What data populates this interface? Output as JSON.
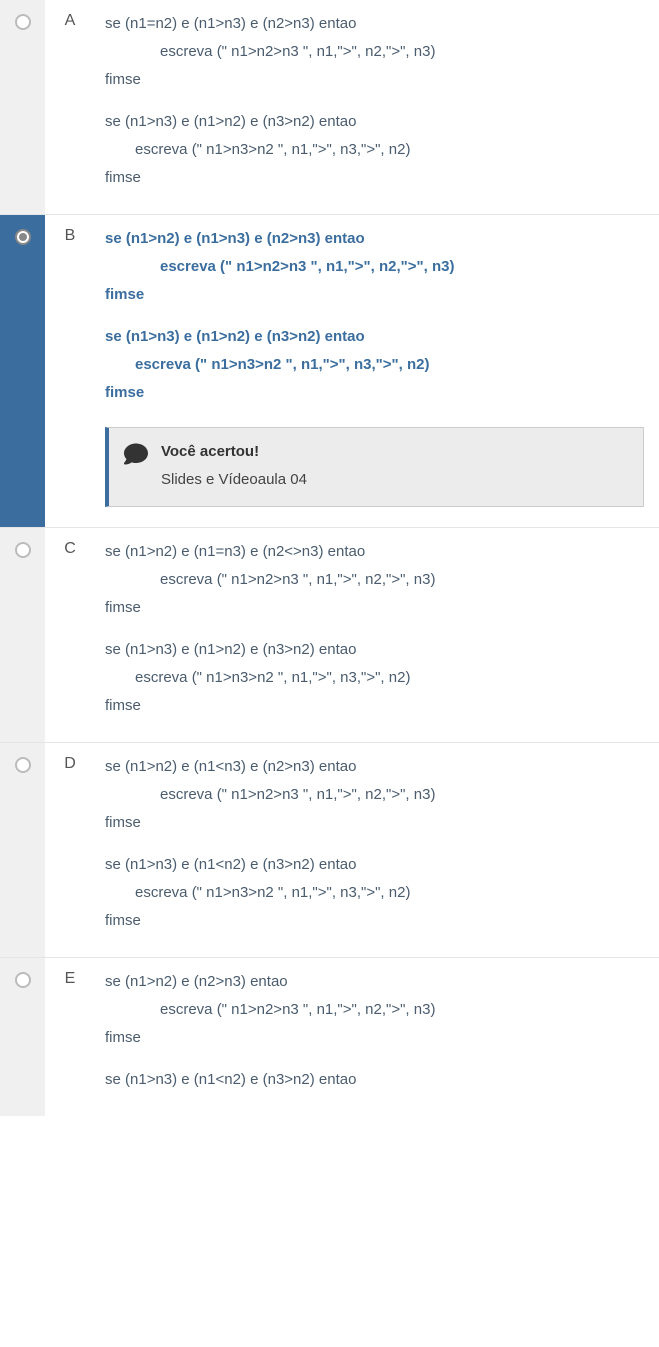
{
  "options": [
    {
      "letter": "A",
      "selected": false,
      "correct": false,
      "lines": [
        {
          "t": "se (n1=n2) e (n1>n3) e (n2>n3) entao",
          "cls": ""
        },
        {
          "t": "escreva (\" n1>n2>n3 \", n1,\">\", n2,\">\", n3)",
          "cls": "indent1"
        },
        {
          "t": "fimse",
          "cls": ""
        },
        {
          "gap": true
        },
        {
          "t": "se (n1>n3) e (n1>n2) e (n3>n2) entao",
          "cls": ""
        },
        {
          "t": "escreva (\" n1>n3>n2 \", n1,\">\", n3,\">\", n2)",
          "cls": "indent2"
        },
        {
          "t": "fimse",
          "cls": ""
        }
      ]
    },
    {
      "letter": "B",
      "selected": true,
      "correct": true,
      "lines": [
        {
          "t": "se (n1>n2) e (n1>n3) e (n2>n3) entao",
          "cls": ""
        },
        {
          "t": "escreva (\" n1>n2>n3 \", n1,\">\", n2,\">\", n3)",
          "cls": "indent1"
        },
        {
          "t": "fimse",
          "cls": ""
        },
        {
          "gap": true
        },
        {
          "t": "se (n1>n3) e (n1>n2) e (n3>n2) entao",
          "cls": ""
        },
        {
          "t": "escreva (\" n1>n3>n2 \", n1,\">\", n3,\">\", n2)",
          "cls": "indent2"
        },
        {
          "t": "fimse",
          "cls": ""
        }
      ],
      "feedback": {
        "title": "Você acertou!",
        "sub": "Slides e Vídeoaula 04"
      }
    },
    {
      "letter": "C",
      "selected": false,
      "correct": false,
      "lines": [
        {
          "t": "se (n1>n2) e (n1=n3) e (n2<>n3) entao",
          "cls": ""
        },
        {
          "t": "escreva (\" n1>n2>n3 \", n1,\">\", n2,\">\", n3)",
          "cls": "indent1"
        },
        {
          "t": "fimse",
          "cls": ""
        },
        {
          "gap": true
        },
        {
          "t": "se (n1>n3) e (n1>n2) e (n3>n2) entao",
          "cls": ""
        },
        {
          "t": "escreva (\" n1>n3>n2 \", n1,\">\", n3,\">\", n2)",
          "cls": "indent2"
        },
        {
          "t": "fimse",
          "cls": ""
        }
      ]
    },
    {
      "letter": "D",
      "selected": false,
      "correct": false,
      "lines": [
        {
          "t": "se (n1>n2) e (n1<n3) e (n2>n3) entao",
          "cls": ""
        },
        {
          "t": "escreva (\" n1>n2>n3 \", n1,\">\", n2,\">\", n3)",
          "cls": "indent1"
        },
        {
          "t": "fimse",
          "cls": ""
        },
        {
          "gap": true
        },
        {
          "t": "se (n1>n3) e (n1<n2) e (n3>n2) entao",
          "cls": ""
        },
        {
          "t": "escreva (\" n1>n3>n2 \", n1,\">\", n3,\">\", n2)",
          "cls": "indent2"
        },
        {
          "t": "fimse",
          "cls": ""
        }
      ]
    },
    {
      "letter": "E",
      "selected": false,
      "correct": false,
      "lines": [
        {
          "t": "se (n1>n2)  e (n2>n3) entao",
          "cls": ""
        },
        {
          "t": "escreva (\" n1>n2>n3 \", n1,\">\", n2,\">\", n3)",
          "cls": "indent1"
        },
        {
          "t": "fimse",
          "cls": ""
        },
        {
          "gap": true
        },
        {
          "t": "se (n1>n3) e (n1<n2) e (n3>n2) entao",
          "cls": ""
        }
      ]
    }
  ]
}
